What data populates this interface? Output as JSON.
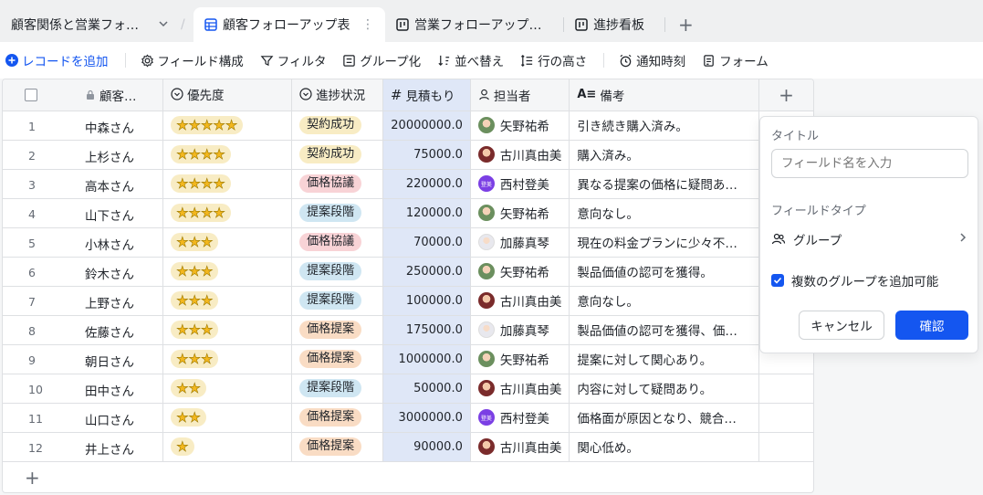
{
  "tabs": [
    {
      "label": "顧客関係と営業フォ…"
    },
    {
      "label": "顧客フォローアップ表"
    },
    {
      "label": "営業フォローアップ…"
    },
    {
      "label": "進捗看板"
    }
  ],
  "toolbar": {
    "add_record": "レコードを追加",
    "field_config": "フィールド構成",
    "filter": "フィルタ",
    "group": "グループ化",
    "sort": "並べ替え",
    "row_height": "行の高さ",
    "notify": "通知時刻",
    "form": "フォーム"
  },
  "columns": {
    "customer": "顧客…",
    "priority": "優先度",
    "progress": "進捗状況",
    "estimate": "見積もり",
    "owner": "担当者",
    "note": "備考"
  },
  "colors": {
    "accent": "#1456f0",
    "status_contract": "#f8ecc4",
    "status_negotiation": "#f8d3d6",
    "status_proposal": "#cfe6f2",
    "status_price": "#f9dcc4"
  },
  "rows": [
    {
      "n": "1",
      "name": "中森さん",
      "stars": "★★★★★",
      "status": "契約成功",
      "status_color": "#f8ecc4",
      "est": "20000000.0",
      "owner": "矢野祐希",
      "av": "a",
      "note": "引き続き購入済み。"
    },
    {
      "n": "2",
      "name": "上杉さん",
      "stars": "★★★★",
      "status": "契約成功",
      "status_color": "#f8ecc4",
      "est": "75000.0",
      "owner": "古川真由美",
      "av": "b",
      "note": "購入済み。"
    },
    {
      "n": "3",
      "name": "高本さん",
      "stars": "★★★★",
      "status": "価格協議",
      "status_color": "#f8d3d6",
      "est": "220000.0",
      "owner": "西村登美",
      "av": "c",
      "note": "異なる提案の価格に疑問あ…"
    },
    {
      "n": "4",
      "name": "山下さん",
      "stars": "★★★★",
      "status": "提案段階",
      "status_color": "#cfe6f2",
      "est": "120000.0",
      "owner": "矢野祐希",
      "av": "a",
      "note": "意向なし。"
    },
    {
      "n": "5",
      "name": "小林さん",
      "stars": "★★★",
      "status": "価格協議",
      "status_color": "#f8d3d6",
      "est": "70000.0",
      "owner": "加藤真琴",
      "av": "d",
      "note": "現在の料金プランに少々不…"
    },
    {
      "n": "6",
      "name": "鈴木さん",
      "stars": "★★★",
      "status": "提案段階",
      "status_color": "#cfe6f2",
      "est": "250000.0",
      "owner": "矢野祐希",
      "av": "a",
      "note": "製品価値の認可を獲得。"
    },
    {
      "n": "7",
      "name": "上野さん",
      "stars": "★★★",
      "status": "提案段階",
      "status_color": "#cfe6f2",
      "est": "100000.0",
      "owner": "古川真由美",
      "av": "b",
      "note": "意向なし。"
    },
    {
      "n": "8",
      "name": "佐藤さん",
      "stars": "★★★",
      "status": "価格提案",
      "status_color": "#f9dcc4",
      "est": "175000.0",
      "owner": "加藤真琴",
      "av": "d",
      "note": "製品価値の認可を獲得、価…"
    },
    {
      "n": "9",
      "name": "朝日さん",
      "stars": "★★★",
      "status": "価格提案",
      "status_color": "#f9dcc4",
      "est": "1000000.0",
      "owner": "矢野祐希",
      "av": "a",
      "note": "提案に対して関心あり。"
    },
    {
      "n": "10",
      "name": "田中さん",
      "stars": "★★",
      "status": "提案段階",
      "status_color": "#cfe6f2",
      "est": "50000.0",
      "owner": "古川真由美",
      "av": "b",
      "note": "内容に対して疑問あり。"
    },
    {
      "n": "11",
      "name": "山口さん",
      "stars": "★★",
      "status": "価格提案",
      "status_color": "#f9dcc4",
      "est": "3000000.0",
      "owner": "西村登美",
      "av": "c",
      "note": "価格面が原因となり、競合…"
    },
    {
      "n": "12",
      "name": "井上さん",
      "stars": "★",
      "status": "価格提案",
      "status_color": "#f9dcc4",
      "est": "90000.0",
      "owner": "古川真由美",
      "av": "b",
      "note": "関心低め。"
    }
  ],
  "popup": {
    "title_label": "タイトル",
    "field_placeholder": "フィールド名を入力",
    "field_type_label": "フィールドタイプ",
    "field_type_value": "グループ",
    "multi_group_label": "複数のグループを追加可能",
    "cancel": "キャンセル",
    "confirm": "確認"
  },
  "avatar_initial_c": "登美"
}
